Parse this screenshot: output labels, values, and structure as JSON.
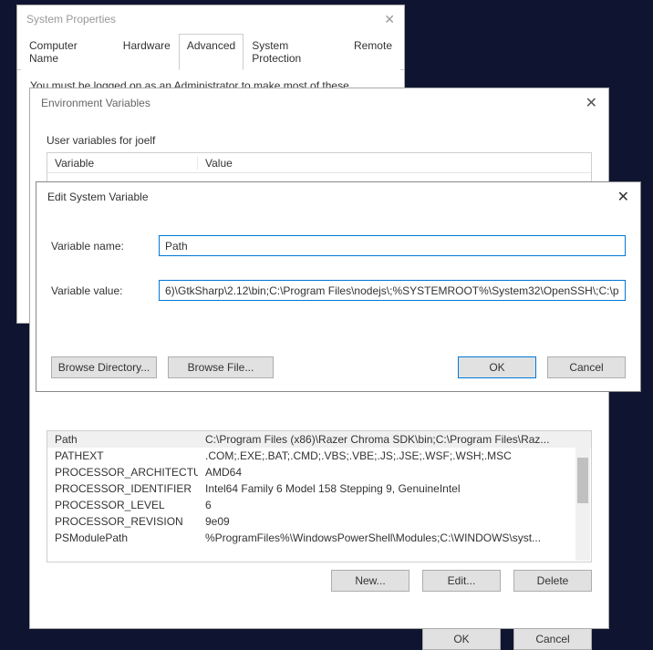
{
  "sysprops": {
    "title": "System Properties",
    "tabs": [
      {
        "label": "Computer Name"
      },
      {
        "label": "Hardware"
      },
      {
        "label": "Advanced"
      },
      {
        "label": "System Protection"
      },
      {
        "label": "Remote"
      }
    ],
    "active_tab_index": 2,
    "body_text": "You must be logged on as an Administrator to make most of these changes."
  },
  "envvars": {
    "title": "Environment Variables",
    "user_section_label": "User variables for joelf",
    "col_variable": "Variable",
    "col_value": "Value",
    "system_vars": [
      {
        "name": "Path",
        "value": "C:\\Program Files (x86)\\Razer Chroma SDK\\bin;C:\\Program Files\\Raz..."
      },
      {
        "name": "PATHEXT",
        "value": ".COM;.EXE;.BAT;.CMD;.VBS;.VBE;.JS;.JSE;.WSF;.WSH;.MSC"
      },
      {
        "name": "PROCESSOR_ARCHITECTURE",
        "value": "AMD64"
      },
      {
        "name": "PROCESSOR_IDENTIFIER",
        "value": "Intel64 Family 6 Model 158 Stepping 9, GenuineIntel"
      },
      {
        "name": "PROCESSOR_LEVEL",
        "value": "6"
      },
      {
        "name": "PROCESSOR_REVISION",
        "value": "9e09"
      },
      {
        "name": "PSModulePath",
        "value": "%ProgramFiles%\\WindowsPowerShell\\Modules;C:\\WINDOWS\\syst..."
      }
    ],
    "selected_system_var_index": 0,
    "buttons": {
      "new": "New...",
      "edit": "Edit...",
      "delete": "Delete",
      "ok": "OK",
      "cancel": "Cancel"
    }
  },
  "editvar": {
    "title": "Edit System Variable",
    "name_label": "Variable name:",
    "name_value": "Path",
    "value_label": "Variable value:",
    "value_value": "6)\\GtkSharp\\2.12\\bin;C:\\Program Files\\nodejs\\;%SYSTEMROOT%\\System32\\OpenSSH\\;C:\\php",
    "buttons": {
      "browse_dir": "Browse Directory...",
      "browse_file": "Browse File...",
      "ok": "OK",
      "cancel": "Cancel"
    }
  }
}
